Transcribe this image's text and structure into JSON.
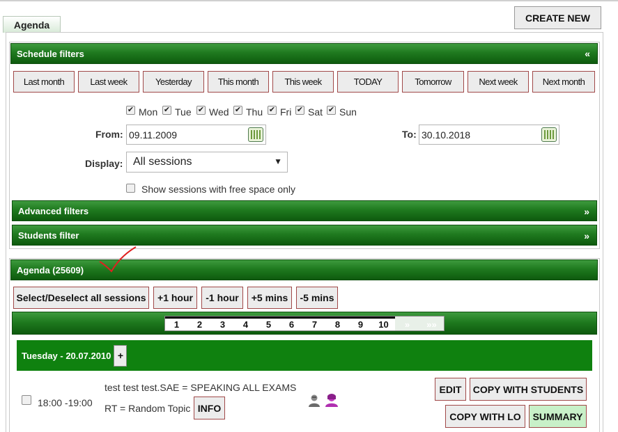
{
  "tab": {
    "label": "Agenda"
  },
  "header": {
    "create_new": "CREATE NEW"
  },
  "schedule_filters": {
    "title": "Schedule filters",
    "collapse_glyph": "«",
    "period_buttons": [
      "Last month",
      "Last week",
      "Yesterday",
      "This month",
      "This week",
      "TODAY",
      "Tomorrow",
      "Next week",
      "Next month"
    ],
    "days": [
      {
        "label": "Mon",
        "checked": true
      },
      {
        "label": "Tue",
        "checked": true
      },
      {
        "label": "Wed",
        "checked": true
      },
      {
        "label": "Thu",
        "checked": true
      },
      {
        "label": "Fri",
        "checked": true
      },
      {
        "label": "Sat",
        "checked": true
      },
      {
        "label": "Sun",
        "checked": true
      }
    ],
    "from_label": "From:",
    "from_value": "09.11.2009",
    "to_label": "To:",
    "to_value": "30.10.2018",
    "display_label": "Display:",
    "display_value": "All sessions",
    "free_space_label": "Show sessions with free space only"
  },
  "advanced_filters": {
    "title": "Advanced filters",
    "glyph": "»"
  },
  "students_filter": {
    "title": "Students filter",
    "glyph": "»"
  },
  "agenda": {
    "title": "Agenda (25609)",
    "actions": [
      "Select/Deselect all sessions",
      "+1 hour",
      "-1 hour",
      "+5 mins",
      "-5 mins"
    ],
    "pages": [
      "1",
      "2",
      "3",
      "4",
      "5",
      "6",
      "7",
      "8",
      "9",
      "10"
    ],
    "page_next": "»",
    "page_last": "»»"
  },
  "day_group": {
    "title": "Tuesday - 20.07.2010",
    "add": "+"
  },
  "session": {
    "time": "18:00 -19:00",
    "line1": "test test test.SAE = SPEAKING ALL EXAMS",
    "line2": "RT = Random Topic",
    "info": "INFO",
    "edit": "EDIT",
    "copy_students": "COPY WITH STUDENTS",
    "copy_lo": "COPY WITH LO",
    "summary": "SUMMARY"
  },
  "colors": {
    "green_dark": "#0e5a0e",
    "green_mid": "#1f7a1f",
    "summary_bg": "#c8f0c8",
    "annotation_red": "#e02020"
  }
}
